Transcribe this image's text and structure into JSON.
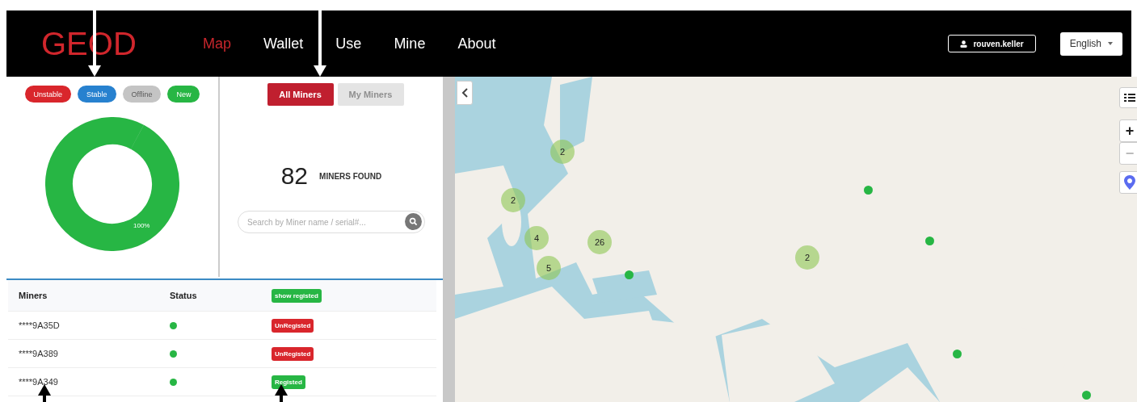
{
  "header": {
    "logo": "GEOD",
    "nav": [
      {
        "label": "Map",
        "selected": true
      },
      {
        "label": "Wallet",
        "selected": false
      },
      {
        "label": "Use",
        "selected": false
      },
      {
        "label": "Mine",
        "selected": false
      },
      {
        "label": "About",
        "selected": false
      }
    ],
    "user": "rouven.keller",
    "language": "English"
  },
  "legend": [
    {
      "label": "Unstable",
      "color": "#d9262c"
    },
    {
      "label": "Stable",
      "color": "#2781cf"
    },
    {
      "label": "Offline",
      "color": "#c4c4c4"
    },
    {
      "label": "New",
      "color": "#27b644"
    }
  ],
  "donut": {
    "level": 1,
    "label": "100%"
  },
  "filter_tabs": [
    {
      "label": "All Miners",
      "selected": true
    },
    {
      "label": "My Miners",
      "selected": false
    }
  ],
  "count": {
    "value": "82",
    "label": "MINERS FOUND"
  },
  "search": {
    "placeholder": "Search by Miner name / serial#..."
  },
  "table": {
    "columns": [
      "Miners",
      "Status"
    ],
    "filter_button": "show registed",
    "rows": [
      {
        "miner": "****9A35D",
        "online": true,
        "registered": false,
        "badge": "UnRegisted"
      },
      {
        "miner": "****9A389",
        "online": true,
        "registered": false,
        "badge": "UnRegisted"
      },
      {
        "miner": "****9A349",
        "online": true,
        "registered": true,
        "badge": "Registed"
      }
    ]
  },
  "map": {
    "clusters": [
      "2",
      "2",
      "4",
      "26",
      "5",
      "2"
    ],
    "zoom_in": "+",
    "zoom_out": "−"
  }
}
